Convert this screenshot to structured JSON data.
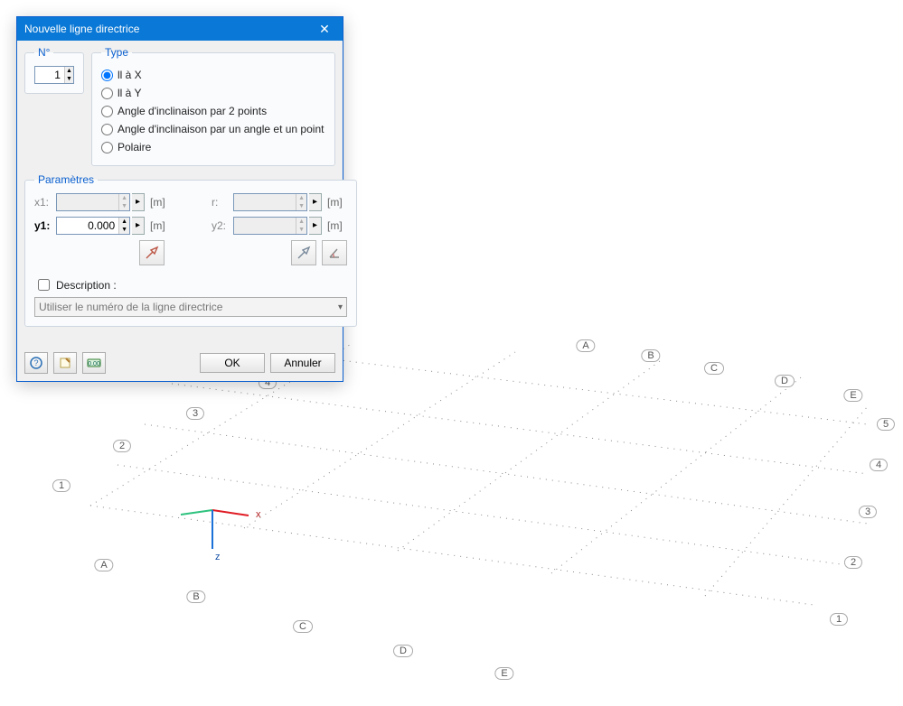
{
  "dialog": {
    "title": "Nouvelle ligne directrice",
    "number_label": "N°",
    "number_value": "1",
    "type_label": "Type",
    "type_options": {
      "opt0": "ll à X",
      "opt1": "ll à Y",
      "opt2": "Angle d'inclinaison par 2 points",
      "opt3": "Angle d'inclinaison par un angle et un point",
      "opt4": "Polaire"
    },
    "params_label": "Paramètres",
    "x1_label": "x1:",
    "y1_label": "y1:",
    "r_label": "r:",
    "y2_label": "y2:",
    "y1_value": "0.000",
    "unit_m": "[m]",
    "desc_check": "Description :",
    "desc_placeholder": "Utiliser le numéro de la ligne directrice",
    "ok": "OK",
    "cancel": "Annuler"
  },
  "viewport": {
    "axis_letters": [
      "A",
      "B",
      "C",
      "D",
      "E"
    ],
    "axis_numbers": [
      "1",
      "2",
      "3",
      "4",
      "5"
    ],
    "gizmo_labels": {
      "x": "x",
      "z": "z"
    }
  }
}
